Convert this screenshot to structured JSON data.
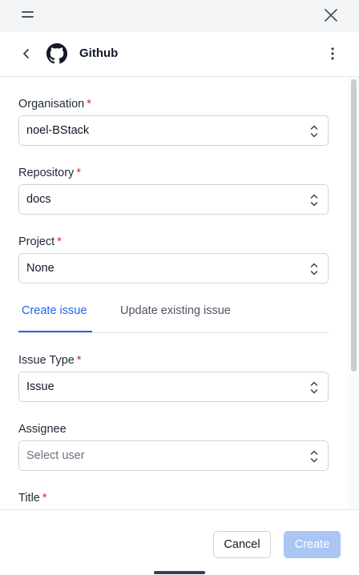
{
  "integration": {
    "title": "Github"
  },
  "form": {
    "organisation": {
      "label": "Organisation",
      "value": "noel-BStack"
    },
    "repository": {
      "label": "Repository",
      "value": "docs"
    },
    "project": {
      "label": "Project",
      "value": "None"
    },
    "tabs": [
      {
        "label": "Create issue",
        "active": true
      },
      {
        "label": "Update existing issue",
        "active": false
      }
    ],
    "issue_type": {
      "label": "Issue Type",
      "value": "Issue"
    },
    "assignee": {
      "label": "Assignee",
      "placeholder": "Select user"
    },
    "title_field": {
      "label": "Title"
    },
    "required_mark": "*"
  },
  "footer": {
    "cancel_label": "Cancel",
    "create_label": "Create"
  },
  "colors": {
    "accent": "#2563eb",
    "required": "#dc2626",
    "create_disabled": "#a9c6f5"
  }
}
